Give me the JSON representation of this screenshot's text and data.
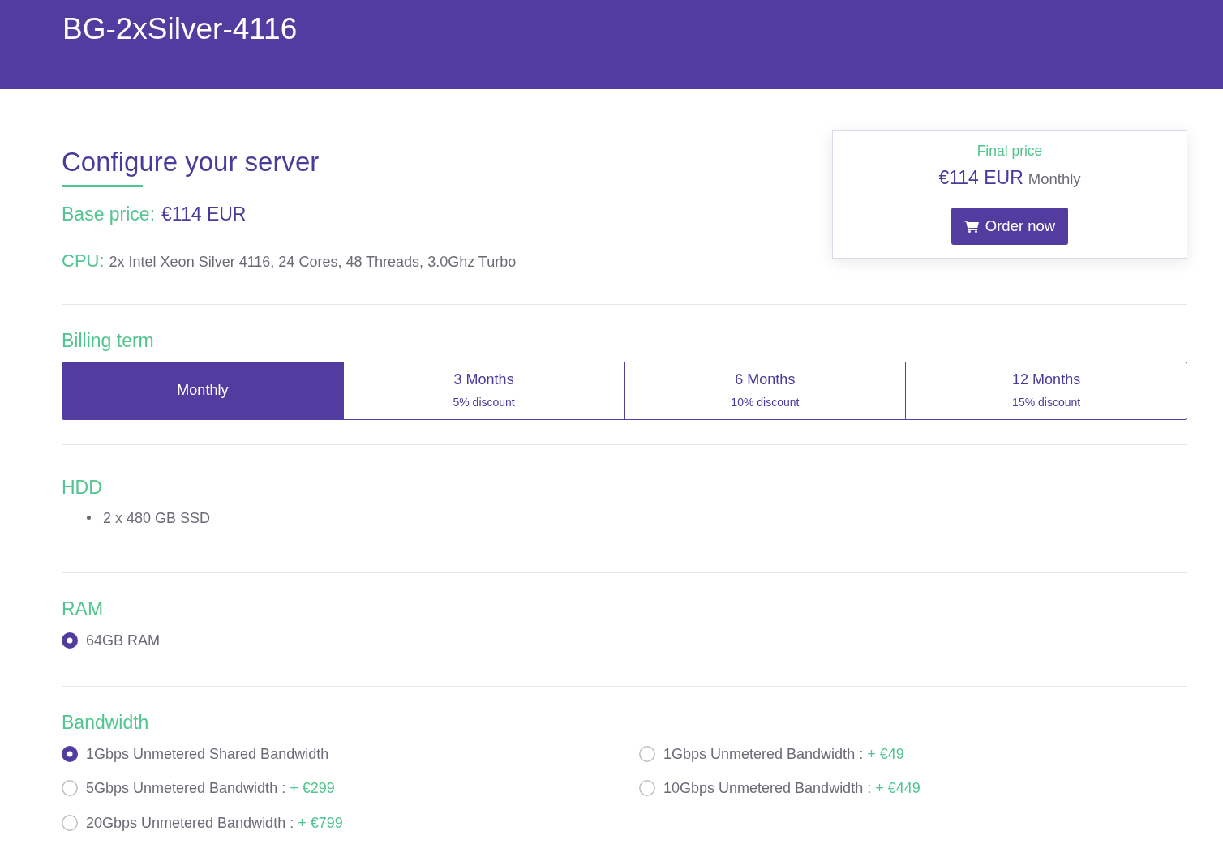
{
  "header": {
    "title": "BG-2xSilver-4116"
  },
  "configure": {
    "heading": "Configure your server",
    "base_price_label": "Base price:",
    "base_price": "€114 EUR",
    "cpu_label": "CPU:",
    "cpu": "2x Intel Xeon Silver 4116, 24 Cores, 48 Threads, 3.0Ghz Turbo"
  },
  "summary": {
    "title": "Final price",
    "price": "€114 EUR",
    "term": "Monthly",
    "order_button": "Order now"
  },
  "billing_term": {
    "heading": "Billing term",
    "options": [
      {
        "label": "Monthly",
        "selected": true
      },
      {
        "label": "3 Months",
        "discount": "5% discount",
        "selected": false
      },
      {
        "label": "6 Months",
        "discount": "10% discount",
        "selected": false
      },
      {
        "label": "12 Months",
        "discount": "15% discount",
        "selected": false
      }
    ]
  },
  "hdd": {
    "heading": "HDD",
    "items": [
      "2 x 480 GB SSD"
    ]
  },
  "ram": {
    "heading": "RAM",
    "options": [
      {
        "label": "64GB RAM",
        "selected": true
      }
    ]
  },
  "bandwidth": {
    "heading": "Bandwidth",
    "options": [
      {
        "label": "1Gbps Unmetered Shared Bandwidth",
        "selected": true
      },
      {
        "label": "1Gbps Unmetered Bandwidth :",
        "price": "+ €49",
        "selected": false
      },
      {
        "label": "5Gbps Unmetered Bandwidth :",
        "price": "+ €299",
        "selected": false
      },
      {
        "label": "10Gbps Unmetered Bandwidth :",
        "price": "+ €449",
        "selected": false
      },
      {
        "label": "20Gbps Unmetered Bandwidth :",
        "price": "+ €799",
        "selected": false
      }
    ]
  }
}
